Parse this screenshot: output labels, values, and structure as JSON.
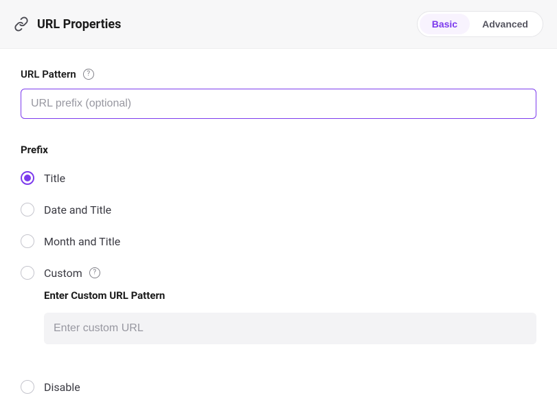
{
  "header": {
    "title": "URL Properties",
    "tabs": {
      "basic": "Basic",
      "advanced": "Advanced"
    }
  },
  "urlPattern": {
    "label": "URL Pattern",
    "placeholder": "URL prefix (optional)",
    "value": ""
  },
  "prefix": {
    "sectionLabel": "Prefix",
    "options": {
      "title": "Title",
      "dateTitle": "Date and Title",
      "monthTitle": "Month and Title",
      "custom": "Custom",
      "disable": "Disable"
    },
    "customSection": {
      "label": "Enter Custom URL Pattern",
      "placeholder": "Enter custom URL",
      "value": ""
    }
  }
}
